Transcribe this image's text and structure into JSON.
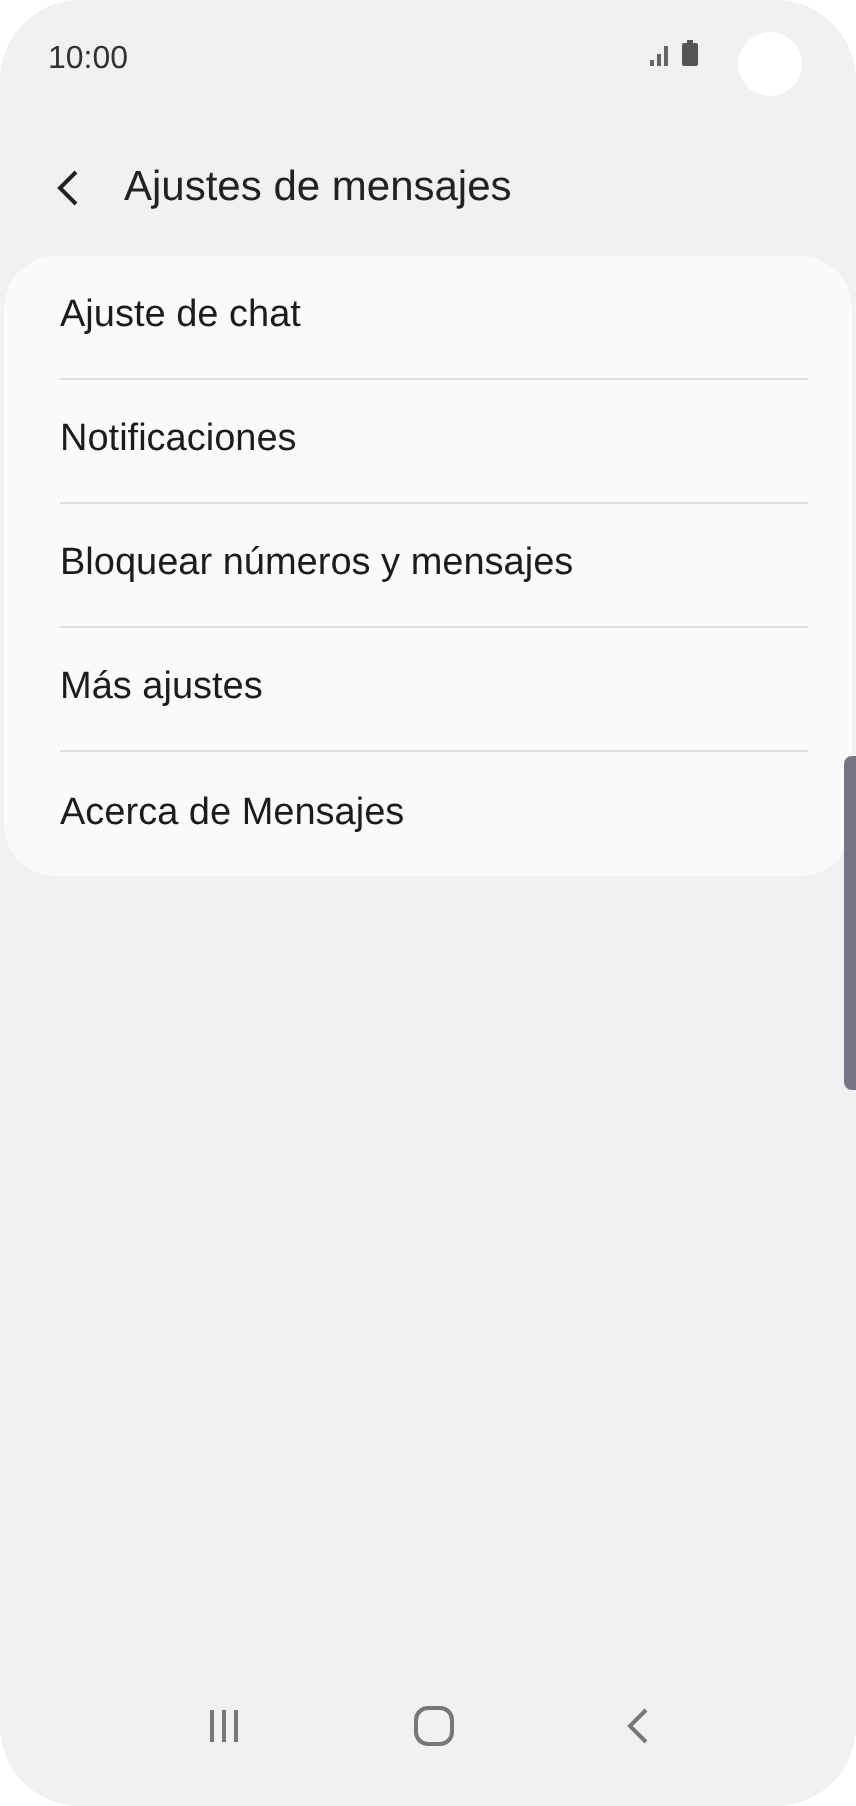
{
  "status_bar": {
    "time": "10:00"
  },
  "header": {
    "title": "Ajustes de mensajes"
  },
  "items": [
    {
      "label": "Ajuste de chat"
    },
    {
      "label": "Notificaciones"
    },
    {
      "label": "Bloquear números y mensajes"
    },
    {
      "label": "Más ajustes"
    },
    {
      "label": "Acerca de Mensajes"
    }
  ]
}
